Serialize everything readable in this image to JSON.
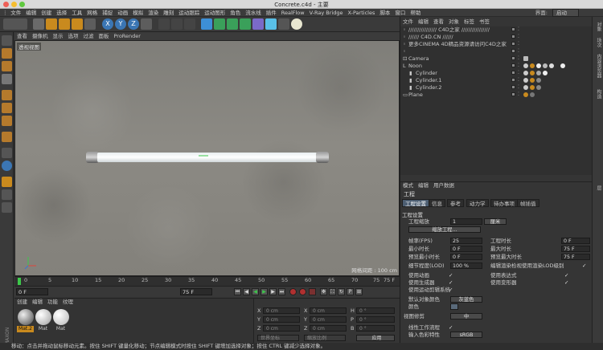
{
  "window": {
    "title": "Concrete.c4d - 主要"
  },
  "menu": {
    "items": [
      "文件",
      "编辑",
      "创建",
      "选择",
      "工具",
      "网格",
      "捕捉",
      "动画",
      "模拟",
      "渲染",
      "雕刻",
      "运动跟踪",
      "运动图形",
      "角色",
      "流水线",
      "插件",
      "RealFlow",
      "V-Ray Bridge",
      "X-Particles",
      "脚本",
      "窗口",
      "帮助"
    ],
    "layout_label": "界面:",
    "layout_value": "启动"
  },
  "viewport": {
    "menu": [
      "查看",
      "摄像机",
      "显示",
      "选项",
      "过滤",
      "面板",
      "ProRender"
    ],
    "label": "透视视图",
    "grid_label": "网格间距 : 100 cm"
  },
  "timeline": {
    "ticks": [
      "0",
      "5",
      "10",
      "15",
      "20",
      "25",
      "30",
      "35",
      "40",
      "45",
      "50",
      "55",
      "60",
      "65",
      "70",
      "75"
    ],
    "end_frame": "75 F",
    "current_frame": "0 F",
    "start_field": "0 F",
    "end_field": "75 F"
  },
  "materials": {
    "menu": [
      "创建",
      "编辑",
      "功能",
      "纹理"
    ],
    "items": [
      {
        "label": "Mat.2",
        "selected": true
      },
      {
        "label": "Mat",
        "selected": false
      },
      {
        "label": "Mat",
        "selected": false
      }
    ]
  },
  "coordinates": {
    "rows": [
      {
        "a": "X",
        "av": "0 cm",
        "b": "X",
        "bv": "0 cm",
        "c": "H",
        "cv": "0 °"
      },
      {
        "a": "Y",
        "av": "0 cm",
        "b": "Y",
        "bv": "0 cm",
        "c": "P",
        "cv": "0 °"
      },
      {
        "a": "Z",
        "av": "0 cm",
        "b": "Z",
        "bv": "0 cm",
        "c": "B",
        "cv": "0 °"
      }
    ],
    "mode_left": "世界坐标",
    "mode_right": "缩放比例",
    "apply": "应用"
  },
  "status": "移动：点击并拖动鼠标移动元素。按住 SHIFT 键量化移动；节点编辑模式时按住 SHIFT 键增加选择对象；按住 CTRL 键减少选择对象。",
  "objects": {
    "menu": [
      "文件",
      "编辑",
      "查看",
      "对象",
      "标签",
      "书签"
    ],
    "rows": [
      {
        "name": "////////////////  C4D之家  ////////////////",
        "indent": 10
      },
      {
        "name": "//////  C4D.CN  //////",
        "indent": 10
      },
      {
        "name": "更多CINEMA 4D精品资源请访问C4D之家",
        "indent": 10
      },
      {
        "name": "",
        "indent": 10
      },
      {
        "name": "Camera",
        "indent": 10
      },
      {
        "name": "Noon",
        "indent": 10
      },
      {
        "name": "Cylinder",
        "indent": 18
      },
      {
        "name": "Cylinder.1",
        "indent": 18
      },
      {
        "name": "Cylinder.2",
        "indent": 18
      },
      {
        "name": "Plane",
        "indent": 10
      }
    ]
  },
  "sidetabs": [
    "对象",
    "场次",
    "内容浏览器",
    "构造",
    "层"
  ],
  "attributes": {
    "menu": [
      "模式",
      "编辑",
      "用户数据"
    ],
    "title": "工程",
    "tabs": [
      "工程设置",
      "信息",
      "参考",
      "动力学",
      "待办事项",
      "帧插值"
    ],
    "section": "工程设置",
    "scale_label": "工程缩放",
    "scale_value": "1",
    "scale_unit": "厘米",
    "scale_button": "缩放工程...",
    "fps_label": "帧率(FPS)",
    "fps_value": "25",
    "duration_label": "工程时长",
    "duration_value": "0 F",
    "min_time_label": "最小时长",
    "min_time_value": "0 F",
    "max_time_label": "最大时长",
    "max_time_value": "75 F",
    "preview_min_label": "预览最小时长",
    "preview_min_value": "0 F",
    "preview_max_label": "预览最大时长",
    "preview_max_value": "75 F",
    "lod_label": "细节程度(LOD)",
    "lod_value": "100 %",
    "lod_check_label": "编辑渲染检视使用渲染LOD级别",
    "checks": [
      {
        "left": "使用动画",
        "right": "使用表达式"
      },
      {
        "left": "使用生成器",
        "right": "使用变形器"
      },
      {
        "left": "使用运动剪辑系统",
        "right": ""
      }
    ],
    "default_color_label": "默认对象颜色",
    "default_color_value": "灰蓝色",
    "color_label": "颜色",
    "view_clip_label": "视图修剪",
    "view_clip_value": "中",
    "linear_workflow_label": "线性工作流程",
    "input_color_label": "输入色彩特性",
    "input_color_value": "sRGB"
  }
}
